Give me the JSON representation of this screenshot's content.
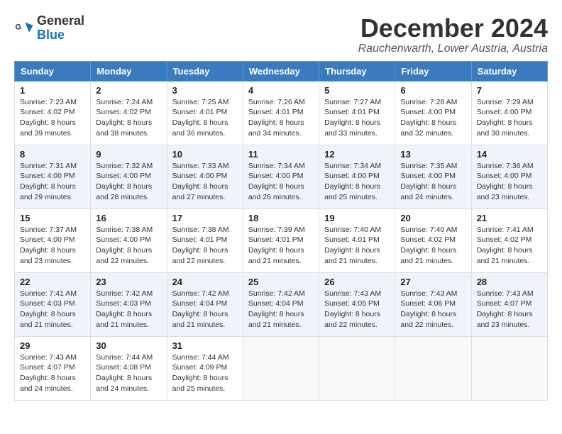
{
  "header": {
    "logo_line1": "General",
    "logo_line2": "Blue",
    "month_title": "December 2024",
    "location": "Rauchenwarth, Lower Austria, Austria"
  },
  "days_of_week": [
    "Sunday",
    "Monday",
    "Tuesday",
    "Wednesday",
    "Thursday",
    "Friday",
    "Saturday"
  ],
  "weeks": [
    [
      {
        "day": "1",
        "sunrise": "7:23 AM",
        "sunset": "4:02 PM",
        "daylight": "8 hours and 39 minutes."
      },
      {
        "day": "2",
        "sunrise": "7:24 AM",
        "sunset": "4:02 PM",
        "daylight": "8 hours and 38 minutes."
      },
      {
        "day": "3",
        "sunrise": "7:25 AM",
        "sunset": "4:01 PM",
        "daylight": "8 hours and 36 minutes."
      },
      {
        "day": "4",
        "sunrise": "7:26 AM",
        "sunset": "4:01 PM",
        "daylight": "8 hours and 34 minutes."
      },
      {
        "day": "5",
        "sunrise": "7:27 AM",
        "sunset": "4:01 PM",
        "daylight": "8 hours and 33 minutes."
      },
      {
        "day": "6",
        "sunrise": "7:28 AM",
        "sunset": "4:00 PM",
        "daylight": "8 hours and 32 minutes."
      },
      {
        "day": "7",
        "sunrise": "7:29 AM",
        "sunset": "4:00 PM",
        "daylight": "8 hours and 30 minutes."
      }
    ],
    [
      {
        "day": "8",
        "sunrise": "7:31 AM",
        "sunset": "4:00 PM",
        "daylight": "8 hours and 29 minutes."
      },
      {
        "day": "9",
        "sunrise": "7:32 AM",
        "sunset": "4:00 PM",
        "daylight": "8 hours and 28 minutes."
      },
      {
        "day": "10",
        "sunrise": "7:33 AM",
        "sunset": "4:00 PM",
        "daylight": "8 hours and 27 minutes."
      },
      {
        "day": "11",
        "sunrise": "7:34 AM",
        "sunset": "4:00 PM",
        "daylight": "8 hours and 26 minutes."
      },
      {
        "day": "12",
        "sunrise": "7:34 AM",
        "sunset": "4:00 PM",
        "daylight": "8 hours and 25 minutes."
      },
      {
        "day": "13",
        "sunrise": "7:35 AM",
        "sunset": "4:00 PM",
        "daylight": "8 hours and 24 minutes."
      },
      {
        "day": "14",
        "sunrise": "7:36 AM",
        "sunset": "4:00 PM",
        "daylight": "8 hours and 23 minutes."
      }
    ],
    [
      {
        "day": "15",
        "sunrise": "7:37 AM",
        "sunset": "4:00 PM",
        "daylight": "8 hours and 23 minutes."
      },
      {
        "day": "16",
        "sunrise": "7:38 AM",
        "sunset": "4:00 PM",
        "daylight": "8 hours and 22 minutes."
      },
      {
        "day": "17",
        "sunrise": "7:38 AM",
        "sunset": "4:01 PM",
        "daylight": "8 hours and 22 minutes."
      },
      {
        "day": "18",
        "sunrise": "7:39 AM",
        "sunset": "4:01 PM",
        "daylight": "8 hours and 21 minutes."
      },
      {
        "day": "19",
        "sunrise": "7:40 AM",
        "sunset": "4:01 PM",
        "daylight": "8 hours and 21 minutes."
      },
      {
        "day": "20",
        "sunrise": "7:40 AM",
        "sunset": "4:02 PM",
        "daylight": "8 hours and 21 minutes."
      },
      {
        "day": "21",
        "sunrise": "7:41 AM",
        "sunset": "4:02 PM",
        "daylight": "8 hours and 21 minutes."
      }
    ],
    [
      {
        "day": "22",
        "sunrise": "7:41 AM",
        "sunset": "4:03 PM",
        "daylight": "8 hours and 21 minutes."
      },
      {
        "day": "23",
        "sunrise": "7:42 AM",
        "sunset": "4:03 PM",
        "daylight": "8 hours and 21 minutes."
      },
      {
        "day": "24",
        "sunrise": "7:42 AM",
        "sunset": "4:04 PM",
        "daylight": "8 hours and 21 minutes."
      },
      {
        "day": "25",
        "sunrise": "7:42 AM",
        "sunset": "4:04 PM",
        "daylight": "8 hours and 21 minutes."
      },
      {
        "day": "26",
        "sunrise": "7:43 AM",
        "sunset": "4:05 PM",
        "daylight": "8 hours and 22 minutes."
      },
      {
        "day": "27",
        "sunrise": "7:43 AM",
        "sunset": "4:06 PM",
        "daylight": "8 hours and 22 minutes."
      },
      {
        "day": "28",
        "sunrise": "7:43 AM",
        "sunset": "4:07 PM",
        "daylight": "8 hours and 23 minutes."
      }
    ],
    [
      {
        "day": "29",
        "sunrise": "7:43 AM",
        "sunset": "4:07 PM",
        "daylight": "8 hours and 24 minutes."
      },
      {
        "day": "30",
        "sunrise": "7:44 AM",
        "sunset": "4:08 PM",
        "daylight": "8 hours and 24 minutes."
      },
      {
        "day": "31",
        "sunrise": "7:44 AM",
        "sunset": "4:09 PM",
        "daylight": "8 hours and 25 minutes."
      },
      null,
      null,
      null,
      null
    ]
  ]
}
